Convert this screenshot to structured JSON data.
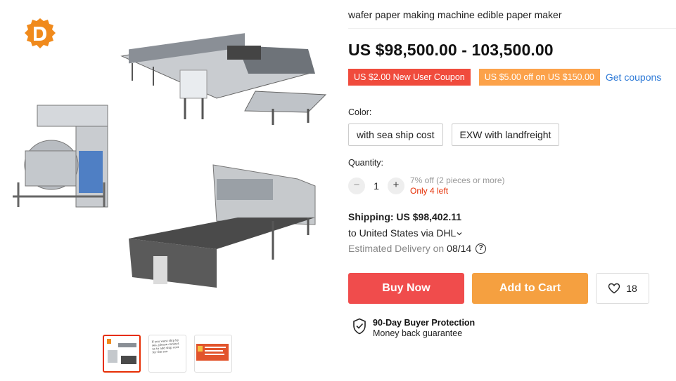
{
  "product": {
    "title": "wafer paper making machine edible paper maker",
    "price": "US $98,500.00 - 103,500.00"
  },
  "coupons": {
    "items": [
      "US $2.00 New User Coupon",
      "US $5.00 off on US $150.00"
    ],
    "get_label": "Get coupons"
  },
  "color": {
    "label": "Color:",
    "options": [
      "with sea ship cost",
      "EXW with landfreight"
    ]
  },
  "quantity": {
    "label": "Quantity:",
    "minus": "−",
    "value": "1",
    "plus": "+",
    "discount": "7% off (2 pieces or more)",
    "stock": "Only 4 left"
  },
  "shipping": {
    "cost": "Shipping: US $98,402.11",
    "destination": "to United States via DHL",
    "estimated_label": "Estimated Delivery on",
    "estimated_date": "08/14",
    "help": "?"
  },
  "actions": {
    "buy": "Buy Now",
    "cart": "Add to Cart",
    "wishlist_count": "18"
  },
  "protection": {
    "title": "90-Day Buyer Protection",
    "subtitle": "Money back guarantee"
  },
  "thumb_text": "If you want ship by sea, please contact us to add ship cost for the sea",
  "colors": {
    "accent_red": "#f04c4c",
    "accent_orange": "#f5a040",
    "link_blue": "#2e7ad7"
  }
}
